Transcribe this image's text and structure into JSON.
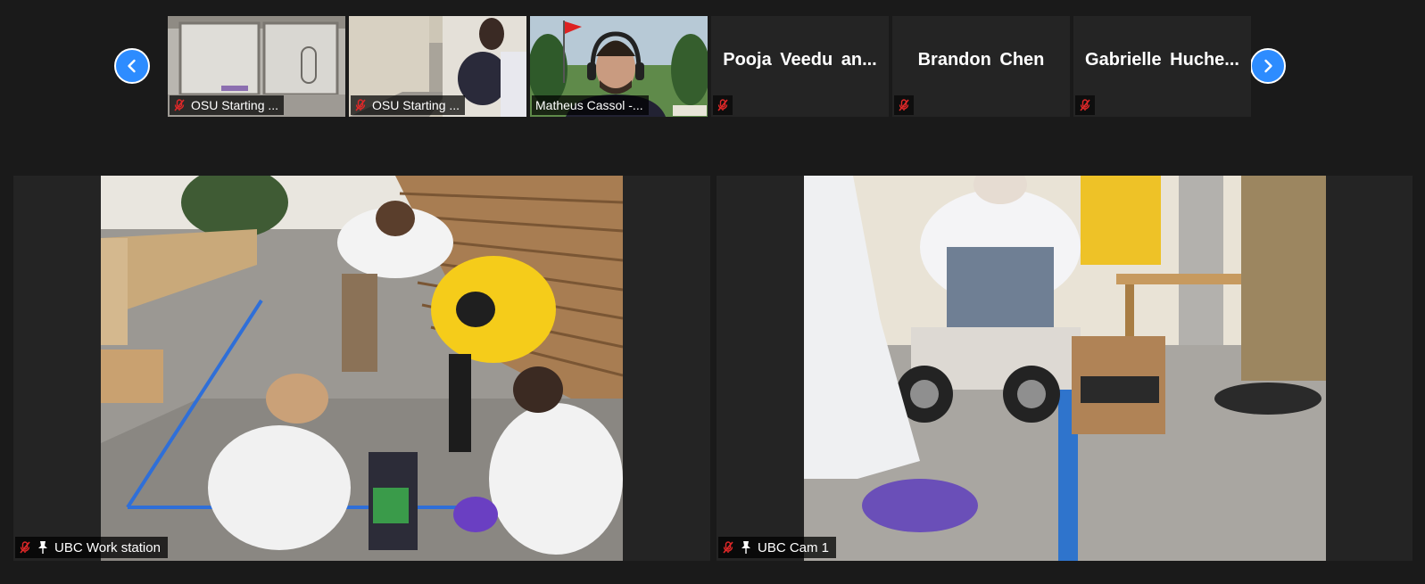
{
  "thumbnails": [
    {
      "name": "OSU Starting ...",
      "type": "video",
      "muted": true
    },
    {
      "name": "OSU Starting ...",
      "type": "video",
      "muted": true
    },
    {
      "name": "Matheus Cassol -...",
      "type": "video",
      "muted": false
    },
    {
      "name": "Pooja Veedu an...",
      "type": "name",
      "muted": true
    },
    {
      "name": "Brandon Chen",
      "type": "name",
      "muted": true
    },
    {
      "name": "Gabrielle Huche...",
      "type": "name",
      "muted": true
    }
  ],
  "tiles": [
    {
      "name": "UBC Work station",
      "muted": true,
      "pinned": true
    },
    {
      "name": "UBC Cam 1",
      "muted": true,
      "pinned": true
    }
  ],
  "icons": {
    "prev": "chevron-left-icon",
    "next": "chevron-right-icon",
    "mute": "mic-muted-icon",
    "pin": "pin-icon"
  },
  "colors": {
    "accent": "#2d8cff",
    "muted_icon": "#e02828",
    "tile_bg": "#242424",
    "page_bg": "#1a1a1a"
  }
}
